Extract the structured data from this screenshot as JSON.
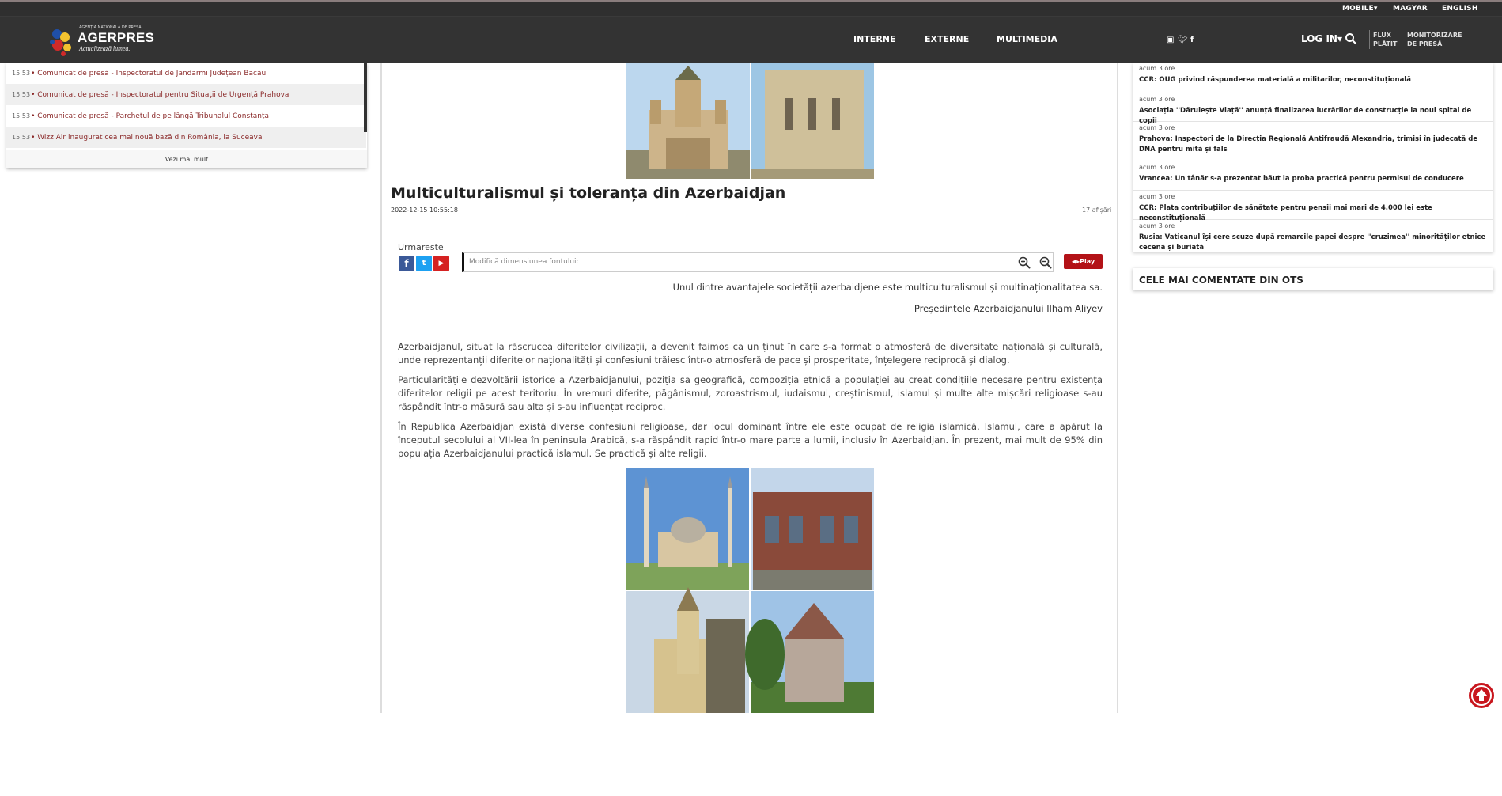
{
  "topbar": {
    "mobile": "MOBILE",
    "magyar": "MAGYAR",
    "english": "ENGLISH"
  },
  "logo": {
    "agency": "AGENȚIA NAȚIONALĂ DE PRESĂ",
    "brand": "AGERPRES",
    "slogan": "Actualizează lumea."
  },
  "nav": {
    "interne": "INTERNE",
    "externe": "EXTERNE",
    "multimedia": "MULTIMEDIA",
    "login": "LOG IN",
    "flux_l1": "FLUX",
    "flux_l2": "PLĂTIT",
    "monit_l1": "MONITORIZARE",
    "monit_l2": "DE PRESĂ"
  },
  "left_feed": {
    "items": [
      {
        "time": "15:53",
        "title": "• Comunicat de presă - Inspectoratul de Jandarmi Județean Bacău"
      },
      {
        "time": "15:53",
        "title": "• Comunicat de presă - Inspectoratul pentru Situații de Urgență Prahova"
      },
      {
        "time": "15:53",
        "title": "• Comunicat de presă - Parchetul de pe lângă Tribunalul Constanța"
      },
      {
        "time": "15:53",
        "title": "• Wizz Air inaugurat cea mai nouă bază din România, la Suceava"
      }
    ],
    "more": "Vezi mai mult"
  },
  "article": {
    "title": "Multiculturalismul și toleranța din Azerbaidjan",
    "date": "2022-12-15 10:55:18",
    "views": "17 afișări",
    "follow": "Urmareste",
    "font_placeholder": "Modifică dimensiunea fontului:",
    "play": "Play",
    "quote": "Unul dintre avantajele societății azerbaidjene este multiculturalismul și multinaționalitatea sa.",
    "quote_author": "Președintele Azerbaidjanului Ilham Aliyev",
    "paragraphs": [
      "Azerbaidjanul, situat la răscrucea diferitelor civilizații, a devenit faimos ca un ținut în care s-a format o atmosferă de diversitate națională și culturală, unde reprezentanții diferitelor naționalități și confesiuni trăiesc într-o atmosferă de pace și prosperitate, înțelegere reciprocă și dialog.",
      "Particularitățile dezvoltării istorice a Azerbaidjanului, poziția sa geografică, compoziția etnică a populației au creat condițiile necesare pentru existența diferitelor religii pe acest teritoriu. În vremuri diferite, păgânismul, zoroastrismul, iudaismul, creștinismul, islamul și multe alte mișcări religioase s-au răspândit într-o măsură sau alta și s-au influențat reciproc.",
      "În Republica Azerbaidjan există diverse confesiuni religioase, dar locul dominant între ele este ocupat de religia islamică. Islamul, care a apărut la începutul secolului al VII-lea în peninsula Arabică, s-a răspândit rapid într-o mare parte a lumii, inclusiv în Azerbaidjan. În prezent, mai mult de 95% din populația Azerbaidjanului practică islamul. Se practică și alte religii."
    ]
  },
  "right_feed": {
    "items": [
      {
        "ago": "acum 3 ore",
        "title": "CCR: OUG privind răspunderea materială a militarilor, neconstituțională"
      },
      {
        "ago": "acum 3 ore",
        "title": "Asociația ''Dăruiește Viață'' anunță finalizarea lucrărilor de construcție la noul spital de copii"
      },
      {
        "ago": "acum 3 ore",
        "title": "Prahova: Inspectori de la Direcția Regională Antifraudă Alexandria, trimiși în judecată de DNA pentru mită și fals"
      },
      {
        "ago": "acum 3 ore",
        "title": "Vrancea: Un tânăr s-a prezentat băut la proba practică pentru permisul de conducere"
      },
      {
        "ago": "acum 3 ore",
        "title": "CCR: Plata contribuțiilor de sănătate pentru pensii mai mari de 4.000 lei este neconstituțională"
      },
      {
        "ago": "acum 3 ore",
        "title": "Rusia: Vaticanul își cere scuze după remarcile papei despre ''cruzimea'' minorităților etnice cecenă și buriată"
      }
    ],
    "most_commented": "CELE MAI COMENTATE DIN OTS"
  },
  "colors": {
    "header_bg": "#333333",
    "link_red": "#8b2a2a",
    "play_red": "#b31217"
  }
}
